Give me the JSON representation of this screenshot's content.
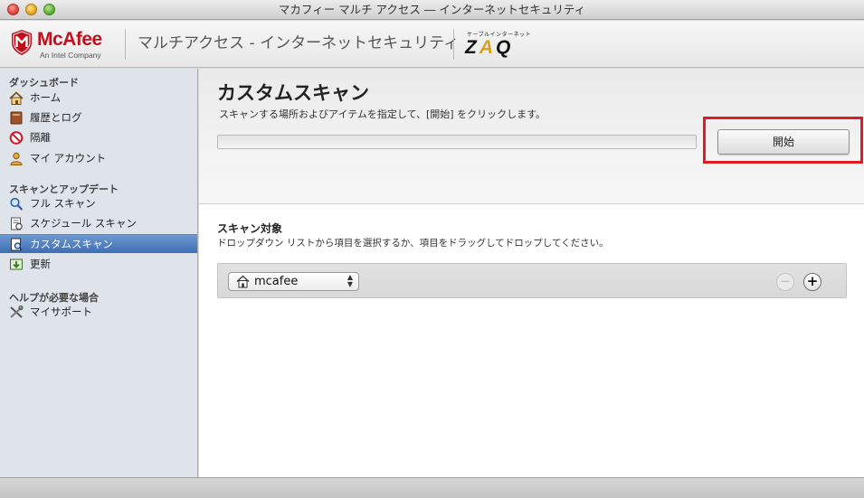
{
  "window": {
    "title": "マカフィー マルチ アクセス ― インターネットセキュリティ"
  },
  "header": {
    "brand": "McAfee",
    "brand_sub": "An Intel Company",
    "app_title": "マルチアクセス - インターネットセキュリティ",
    "partner_caption": "ケーブルインターネット",
    "partner_logo": "ZAQ"
  },
  "sidebar": {
    "sections": [
      {
        "label": "ダッシュボード",
        "items": [
          {
            "label": "ホーム",
            "icon": "home-icon"
          },
          {
            "label": "履歴とログ",
            "icon": "book-icon"
          },
          {
            "label": "隔離",
            "icon": "prohibited-icon"
          },
          {
            "label": "マイ アカウント",
            "icon": "user-icon"
          }
        ]
      },
      {
        "label": "スキャンとアップデート",
        "items": [
          {
            "label": "フル スキャン",
            "icon": "magnifier-icon"
          },
          {
            "label": "スケジュール スキャン",
            "icon": "schedule-document-icon"
          },
          {
            "label": "カスタムスキャン",
            "icon": "custom-scan-icon",
            "selected": true
          },
          {
            "label": "更新",
            "icon": "update-icon"
          }
        ]
      },
      {
        "label": "ヘルプが必要な場合",
        "items": [
          {
            "label": "マイサポート",
            "icon": "tools-icon"
          }
        ]
      }
    ]
  },
  "main": {
    "title": "カスタムスキャン",
    "description": "スキャンする場所およびアイテムを指定して、[開始] をクリックします。",
    "start_button": "開始",
    "progress": 0,
    "target": {
      "title": "スキャン対象",
      "description": "ドロップダウン リストから項目を選択するか、項目をドラッグしてドロップしてください。",
      "selected": "mcafee",
      "remove_label": "−",
      "add_label": "+"
    }
  },
  "colors": {
    "brand_red": "#c0101e",
    "selection_blue": "#3e6fb3",
    "highlight_red": "#e11b22",
    "zaq_accent": "#d8a11a"
  }
}
